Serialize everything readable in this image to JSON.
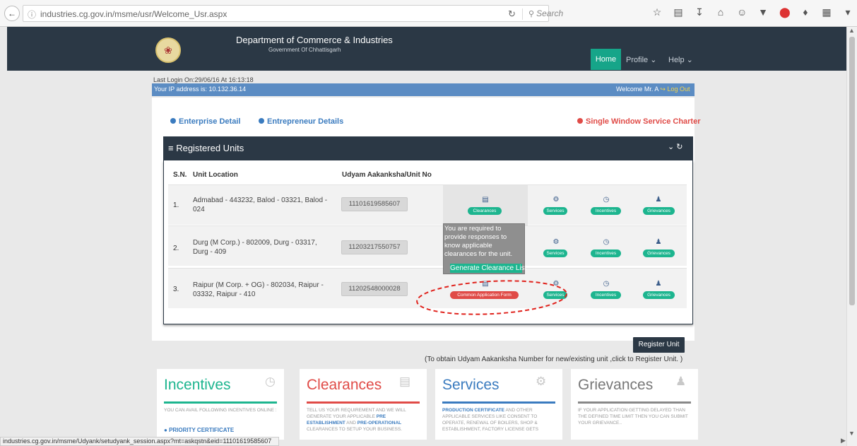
{
  "browser": {
    "url": "industries.cg.gov.in/msme/usr/Welcome_Usr.aspx",
    "search_placeholder": "Search"
  },
  "header": {
    "title": "Department of Commerce & Industries",
    "subtitle": "Government Of Chhattisgarh",
    "nav": {
      "home": "Home",
      "profile": "Profile ⌄",
      "help": "Help ⌄"
    }
  },
  "session": {
    "last_login": "Last Login On:29/06/16 At 16:13:18",
    "ip": "Your IP address is: 10.132.36.14",
    "welcome": "Welcome Mr. A",
    "logout": "Log Out"
  },
  "links": {
    "enterprise": "Enterprise Detail",
    "entrepreneur": "Entrepreneur Details",
    "charter": "Single Window Service Charter"
  },
  "panel": {
    "title": "≡ Registered Units",
    "controls": "⌄ ↻",
    "columns": {
      "sn": "S.N.",
      "location": "Unit Location",
      "unit_no": "Udyam Aakanksha/Unit No"
    },
    "rows": [
      {
        "sn": "1.",
        "location": "Admabad - 443232, Balod - 03321, Balod - 024",
        "unit_no": "11101619585607",
        "clearance": "Clearances"
      },
      {
        "sn": "2.",
        "location": "Durg (M Corp.) - 802009, Durg - 03317, Durg - 409",
        "unit_no": "11203217550757",
        "clearance": ""
      },
      {
        "sn": "3.",
        "location": "Raipur (M Corp. + OG) - 802034, Raipur - 03332, Raipur - 410",
        "unit_no": "11202548000028",
        "clearance": "Common Application Form"
      }
    ],
    "actions": {
      "services": "Services",
      "incentives": "Incentives",
      "grievances": "Grievances"
    },
    "tooltip": {
      "text": "You are required to provide responses to know applicable clearances for the unit.",
      "button": "Generate Clearance List"
    }
  },
  "register": {
    "button": "Register Unit",
    "note": "(To obtain Udyam Aakanksha Number for new/existing unit ,click to Register Unit. )"
  },
  "tiles": {
    "incentives": {
      "title": "Incentives",
      "text": "YOU CAN AVAIL FOLLOWING INCENTIVES ONLINE :",
      "item": "PRIORITY CERTIFICATE"
    },
    "clearances": {
      "title": "Clearances",
      "t1": "TELL US YOUR REQUIREMENT AND WE WILL GENERATE YOUR APPLICABLE ",
      "b1": "PRE ESTABLISHMENT",
      "t2": " AND ",
      "b2": "PRE-OPERATIONAL",
      "t3": " CLEARANCES TO SETUP YOUR BUSINESS."
    },
    "services": {
      "title": "Services",
      "b1": "PRODUCTION CERTIFICATE",
      "t1": " AND OTHER APPLICABLE SERVICES LIKE CONSENT TO OPERATE, RENEWAL OF BOILERS, SHOP & ESTABLISHMENT, FACTORY LICENSE GETS"
    },
    "grievances": {
      "title": "Grievances",
      "text": "IF YOUR APPLICATION GETTING DELAYED THAN THE DEFINED TIME LIMIT THEN YOU CAN SUBMIT YOUR GRIEVANCE.."
    }
  },
  "status_url": "industries.cg.gov.in/msme/Udyank/setudyank_session.aspx?mt=askqstn&eid=11101619585607",
  "colors": {
    "navy": "#2b3845",
    "teal": "#1db58f",
    "red": "#e04b47",
    "blue": "#3a7bbf",
    "ip_bar": "#5b8cc3"
  }
}
